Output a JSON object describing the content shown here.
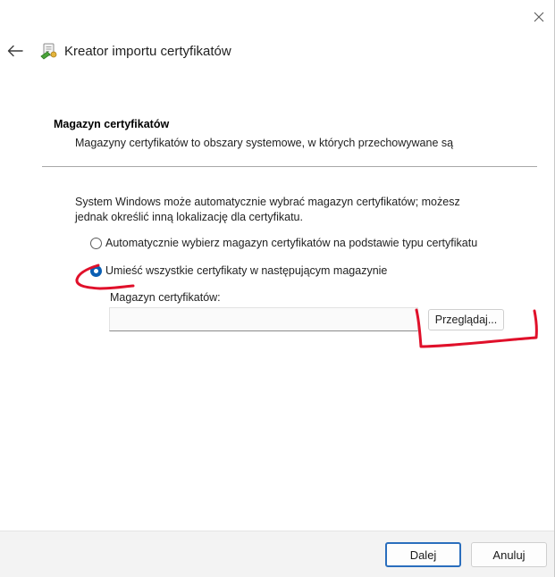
{
  "window": {
    "title": "Kreator importu certyfikatów",
    "close_icon": "close-icon",
    "back_icon": "back-arrow-icon",
    "wizard_icon": "certificate-wizard-icon"
  },
  "section": {
    "heading": "Magazyn certyfikatów",
    "description": "Magazyny certyfikatów to obszary systemowe, w których przechowywane są"
  },
  "intro": {
    "line1": "System Windows może automatycznie wybrać magazyn certyfikatów; możesz",
    "line2": "jednak określić inną lokalizację dla certyfikatu."
  },
  "options": {
    "auto_label": "Automatycznie wybierz magazyn certyfikatów na podstawie typu certyfikatu",
    "auto_selected": false,
    "manual_label": "Umieść wszystkie certyfikaty w następującym magazynie",
    "manual_selected": true
  },
  "store": {
    "label": "Magazyn certyfikatów:",
    "value": "",
    "browse_label": "Przeglądaj..."
  },
  "footer": {
    "next_label": "Dalej",
    "cancel_label": "Anuluj"
  },
  "colors": {
    "accent": "#0a5fb4",
    "annotation": "#e0102a",
    "footer_bg": "#f3f3f3"
  }
}
